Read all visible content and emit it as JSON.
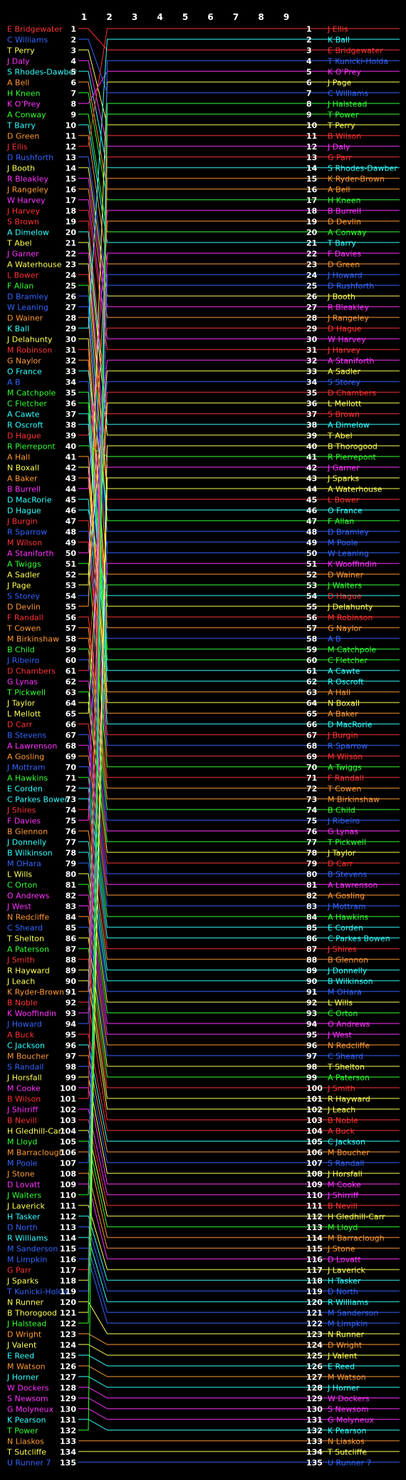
{
  "chart_data": {
    "type": "line",
    "x": [
      0,
      1,
      2,
      3,
      4,
      5,
      6,
      7,
      8,
      9,
      10
    ],
    "x_tick_labels": [
      "1",
      "2",
      "3",
      "4",
      "5",
      "6",
      "7",
      "8",
      "9"
    ],
    "y_max": 135,
    "start": [
      {
        "name": "E Bridgewater",
        "c": "#ff3333"
      },
      {
        "name": "C Williams",
        "c": "#3366ff"
      },
      {
        "name": "T Perry",
        "c": "#ffff55"
      },
      {
        "name": "J Daly",
        "c": "#ff33ff"
      },
      {
        "name": "S Rhodes-Dawber",
        "c": "#33ffff"
      },
      {
        "name": "A Bell",
        "c": "#ff9933"
      },
      {
        "name": "H Kneen",
        "c": "#33ff33"
      },
      {
        "name": "K O’Prey",
        "c": "#ff33ff"
      },
      {
        "name": "A Conway",
        "c": "#33ff33"
      },
      {
        "name": "T Barry",
        "c": "#33ffff"
      },
      {
        "name": "D Green",
        "c": "#ff9933"
      },
      {
        "name": "J Ellis",
        "c": "#ff3333"
      },
      {
        "name": "D Rushforth",
        "c": "#3366ff"
      },
      {
        "name": "J Booth",
        "c": "#ffff55"
      },
      {
        "name": "R Bleakley",
        "c": "#ff33ff"
      },
      {
        "name": "J Rangeley",
        "c": "#ff9933"
      },
      {
        "name": "W Harvey",
        "c": "#ff33ff"
      },
      {
        "name": "J Harvey",
        "c": "#ff3333"
      },
      {
        "name": "S Brown",
        "c": "#ff3333"
      },
      {
        "name": "A Dimelow",
        "c": "#33ffff"
      },
      {
        "name": "T Abel",
        "c": "#ffff55"
      },
      {
        "name": "J Garner",
        "c": "#ff33ff"
      },
      {
        "name": "A Waterhouse",
        "c": "#ffff55"
      },
      {
        "name": "L Bower",
        "c": "#ff3333"
      },
      {
        "name": "F Allan",
        "c": "#33ff33"
      },
      {
        "name": "D Bramley",
        "c": "#3366ff"
      },
      {
        "name": "W Leaning",
        "c": "#3366ff"
      },
      {
        "name": "D Wainer",
        "c": "#ff9933"
      },
      {
        "name": "K Ball",
        "c": "#33ffff"
      },
      {
        "name": "J Delahunty",
        "c": "#ffff55"
      },
      {
        "name": "M Robinson",
        "c": "#ff3333"
      },
      {
        "name": "G Naylor",
        "c": "#ff9933"
      },
      {
        "name": "O France",
        "c": "#33ffff"
      },
      {
        "name": "A B",
        "c": "#3366ff"
      },
      {
        "name": "M Catchpole",
        "c": "#33ff33"
      },
      {
        "name": "C Fletcher",
        "c": "#33ff33"
      },
      {
        "name": "A Cawte",
        "c": "#33ffff"
      },
      {
        "name": "R Oscroft",
        "c": "#33ffff"
      },
      {
        "name": "D Hague",
        "c": "#ff3333"
      },
      {
        "name": "R Pierrepont",
        "c": "#33ff33"
      },
      {
        "name": "A Hall",
        "c": "#ff9933"
      },
      {
        "name": "N Boxall",
        "c": "#ffff55"
      },
      {
        "name": "A Baker",
        "c": "#ff9933"
      },
      {
        "name": "B Burrell",
        "c": "#ff33ff"
      },
      {
        "name": "D MacRorie",
        "c": "#33ffff"
      },
      {
        "name": "D Hague",
        "c": "#33ffff"
      },
      {
        "name": "J Burgin",
        "c": "#ff3333"
      },
      {
        "name": "R Sparrow",
        "c": "#3366ff"
      },
      {
        "name": "M Wilson",
        "c": "#ff3333"
      },
      {
        "name": "A Staniforth",
        "c": "#ff33ff"
      },
      {
        "name": "A Twiggs",
        "c": "#33ff33"
      },
      {
        "name": "A Sadler",
        "c": "#ffff55"
      },
      {
        "name": "J Page",
        "c": "#ffff55"
      },
      {
        "name": "S Storey",
        "c": "#3366ff"
      },
      {
        "name": "D Devlin",
        "c": "#ff9933"
      },
      {
        "name": "F Randall",
        "c": "#ff3333"
      },
      {
        "name": "T Cowen",
        "c": "#ff9933"
      },
      {
        "name": "M Birkinshaw",
        "c": "#ff9933"
      },
      {
        "name": "B Child",
        "c": "#33ff33"
      },
      {
        "name": "J Ribeiro",
        "c": "#3366ff"
      },
      {
        "name": "D Chambers",
        "c": "#ff3333"
      },
      {
        "name": "G Lynas",
        "c": "#ff33ff"
      },
      {
        "name": "T Pickwell",
        "c": "#33ff33"
      },
      {
        "name": "J Taylor",
        "c": "#ffff55"
      },
      {
        "name": "L Mellott",
        "c": "#ffff55"
      },
      {
        "name": "D Carr",
        "c": "#ff3333"
      },
      {
        "name": "B Stevens",
        "c": "#3366ff"
      },
      {
        "name": "A Lawrenson",
        "c": "#ff33ff"
      },
      {
        "name": "A Gosling",
        "c": "#ff9933"
      },
      {
        "name": "J Mottram",
        "c": "#3366ff"
      },
      {
        "name": "A Hawkins",
        "c": "#33ff33"
      },
      {
        "name": "E Corden",
        "c": "#33ffff"
      },
      {
        "name": "C Parkes Bowen",
        "c": "#33ffff"
      },
      {
        "name": "J Shires",
        "c": "#ff3333"
      },
      {
        "name": "F Davies",
        "c": "#ff33ff"
      },
      {
        "name": "B Glennon",
        "c": "#ff9933"
      },
      {
        "name": "J Donnelly",
        "c": "#33ffff"
      },
      {
        "name": "B Wilkinson",
        "c": "#33ffff"
      },
      {
        "name": "M OHara",
        "c": "#3366ff"
      },
      {
        "name": "L Wills",
        "c": "#ffff55"
      },
      {
        "name": "C Orton",
        "c": "#33ff33"
      },
      {
        "name": "O Andrews",
        "c": "#ff33ff"
      },
      {
        "name": "J West",
        "c": "#ff33ff"
      },
      {
        "name": "N Redcliffe",
        "c": "#ff9933"
      },
      {
        "name": "C Sheard",
        "c": "#3366ff"
      },
      {
        "name": "T Shelton",
        "c": "#ffff55"
      },
      {
        "name": "A Paterson",
        "c": "#33ff33"
      },
      {
        "name": "J Smith",
        "c": "#ff3333"
      },
      {
        "name": "R Hayward",
        "c": "#ffff55"
      },
      {
        "name": "J Leach",
        "c": "#ffff55"
      },
      {
        "name": "K Ryder-Brown",
        "c": "#ff9933"
      },
      {
        "name": "B Noble",
        "c": "#ff3333"
      },
      {
        "name": "K Wooffindin",
        "c": "#ff33ff"
      },
      {
        "name": "J Howard",
        "c": "#3366ff"
      },
      {
        "name": "A Buck",
        "c": "#ff3333"
      },
      {
        "name": "C Jackson",
        "c": "#33ffff"
      },
      {
        "name": "M Boucher",
        "c": "#ff9933"
      },
      {
        "name": "S Randall",
        "c": "#3366ff"
      },
      {
        "name": "J Horsfall",
        "c": "#ffff55"
      },
      {
        "name": "M Cooke",
        "c": "#ff33ff"
      },
      {
        "name": "B Wilson",
        "c": "#ff3333"
      },
      {
        "name": "J Shirriff",
        "c": "#ff33ff"
      },
      {
        "name": "B Nevill",
        "c": "#ff3333"
      },
      {
        "name": "H Gledhill-Carr",
        "c": "#ffff55"
      },
      {
        "name": "M Lloyd",
        "c": "#33ff33"
      },
      {
        "name": "M Barraclough",
        "c": "#ff9933"
      },
      {
        "name": "M Poole",
        "c": "#3366ff"
      },
      {
        "name": "J Stone",
        "c": "#ff9933"
      },
      {
        "name": "D Lovatt",
        "c": "#ff33ff"
      },
      {
        "name": "J Walters",
        "c": "#33ff33"
      },
      {
        "name": "J Laverick",
        "c": "#ffff55"
      },
      {
        "name": "H Tasker",
        "c": "#33ffff"
      },
      {
        "name": "D North",
        "c": "#3366ff"
      },
      {
        "name": "R Williams",
        "c": "#33ffff"
      },
      {
        "name": "M Sanderson",
        "c": "#3366ff"
      },
      {
        "name": "M Limpkin",
        "c": "#3366ff"
      },
      {
        "name": "G Parr",
        "c": "#ff3333"
      },
      {
        "name": "J Sparks",
        "c": "#ffff55"
      },
      {
        "name": "T Kunicki-Holda",
        "c": "#3366ff"
      },
      {
        "name": "N Runner",
        "c": "#ffff55"
      },
      {
        "name": "B Thorogood",
        "c": "#ffff55"
      },
      {
        "name": "J Halstead",
        "c": "#33ff33"
      },
      {
        "name": "D Wright",
        "c": "#ff9933"
      },
      {
        "name": "J Valent",
        "c": "#ffff55"
      },
      {
        "name": "E Reed",
        "c": "#33ffff"
      },
      {
        "name": "M Watson",
        "c": "#ff9933"
      },
      {
        "name": "J Horner",
        "c": "#33ffff"
      },
      {
        "name": "W Dockers",
        "c": "#ff33ff"
      },
      {
        "name": "S Newsom",
        "c": "#ff33ff"
      },
      {
        "name": "G Molyneux",
        "c": "#ff33ff"
      },
      {
        "name": "K Pearson",
        "c": "#33ffff"
      },
      {
        "name": "T Power",
        "c": "#33ff33"
      },
      {
        "name": "N Liaskos",
        "c": "#ff9933"
      },
      {
        "name": "T Sutcliffe",
        "c": "#ffff55"
      },
      {
        "name": "U Runner 7",
        "c": "#3366ff"
      }
    ],
    "end": [
      "J Ellis",
      "K Ball",
      "E Bridgewater",
      "T Kunicki-Holda",
      "K O’Prey",
      "J Page",
      "C Williams",
      "J Halstead",
      "T Power",
      "T Perry",
      "B Wilson",
      "J Daly",
      "G Parr",
      "S Rhodes-Dawber",
      "K Ryder-Brown",
      "A Bell",
      "H Kneen",
      "B Burrell",
      "D Devlin",
      "A Conway",
      "T Barry",
      "F Davies",
      "D Green",
      "J Howard",
      "D Rushforth",
      "J Booth",
      "R Bleakley",
      "J Rangeley",
      "D Hague",
      "W Harvey",
      "J Harvey",
      "A Staniforth",
      "A Sadler",
      "S Storey",
      "D Chambers",
      "L Mellott",
      "S Brown",
      "A Dimelow",
      "T Abel",
      "B Thorogood",
      "R Pierrepont",
      "J Garner",
      "J Sparks",
      "A Waterhouse",
      "L Bower",
      "O France",
      "F Allan",
      "D Bramley",
      "M Poole",
      "W Leaning",
      "K Wooffindin",
      "D Wainer",
      "J Walters",
      "D Hague",
      "J Delahunty",
      "M Robinson",
      "G Naylor",
      "A B",
      "M Catchpole",
      "C Fletcher",
      "A Cawte",
      "R Oscroft",
      "A Hall",
      "N Boxall",
      "A Baker",
      "D MacRorie",
      "J Burgin",
      "R Sparrow",
      "M Wilson",
      "A Twiggs",
      "F Randall",
      "T Cowen",
      "M Birkinshaw",
      "B Child",
      "J Ribeiro",
      "G Lynas",
      "T Pickwell",
      "J Taylor",
      "D Carr",
      "B Stevens",
      "A Lawrenson",
      "A Gosling",
      "J Mottram",
      "A Hawkins",
      "E Corden",
      "C Parkes Bowen",
      "J Shires",
      "B Glennon",
      "J Donnelly",
      "B Wilkinson",
      "M OHara",
      "L Wills",
      "C Orton",
      "O Andrews",
      "J West",
      "N Redcliffe",
      "C Sheard",
      "T Shelton",
      "A Paterson",
      "J Smith",
      "R Hayward",
      "J Leach",
      "B Noble",
      "A Buck",
      "C Jackson",
      "M Boucher",
      "S Randall",
      "J Horsfall",
      "M Cooke",
      "J Shirriff",
      "B Nevill",
      "H Gledhill-Carr",
      "M Lloyd",
      "M Barraclough",
      "J Stone",
      "D Lovatt",
      "J Laverick",
      "H Tasker",
      "D North",
      "R Williams",
      "M Sanderson",
      "M Limpkin",
      "N Runner",
      "D Wright",
      "J Valent",
      "E Reed",
      "M Watson",
      "J Horner",
      "W Dockers",
      "S Newsom",
      "G Molyneux",
      "K Pearson",
      "N Liaskos",
      "T Sutcliffe",
      "U Runner 7"
    ]
  }
}
